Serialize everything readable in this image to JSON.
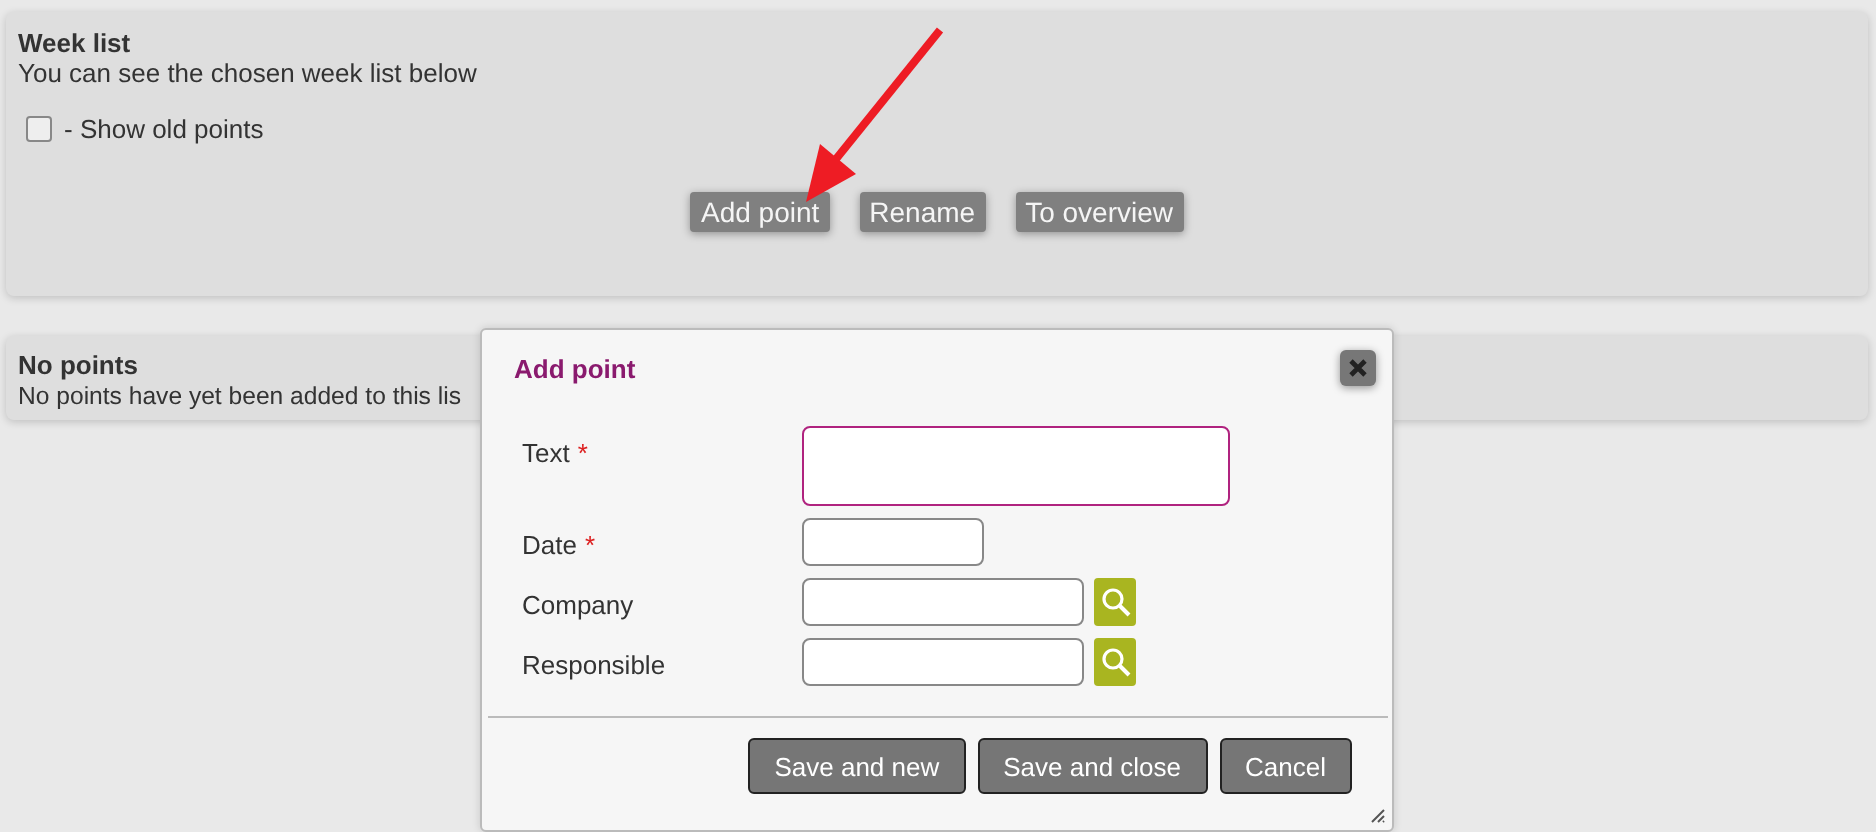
{
  "week_panel": {
    "title": "Week list",
    "subtitle": "You can see the chosen week list below",
    "show_old": {
      "label": "- Show old points",
      "checked": false
    },
    "buttons": [
      "Add point",
      "Rename",
      "To overview"
    ]
  },
  "points_panel": {
    "title": "No points",
    "message": "No points have yet been added to this lis"
  },
  "dialog": {
    "title": "Add point",
    "fields": [
      {
        "label": "Text",
        "required": true,
        "kind": "textarea",
        "focused": true
      },
      {
        "label": "Date",
        "required": true,
        "kind": "short",
        "focused": false
      },
      {
        "label": "Company",
        "required": false,
        "kind": "lookup",
        "focused": false
      },
      {
        "label": "Responsible",
        "required": false,
        "kind": "lookup",
        "focused": false
      }
    ],
    "required_mark": "*",
    "buttons": [
      "Save and new",
      "Save and close",
      "Cancel"
    ]
  }
}
